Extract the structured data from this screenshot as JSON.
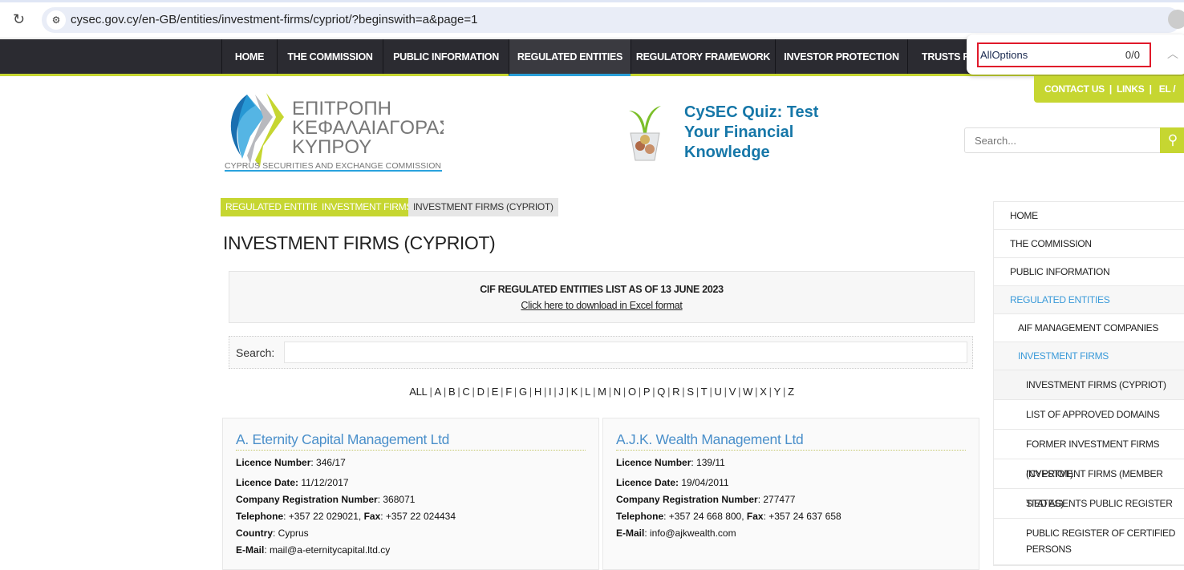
{
  "browser": {
    "url": "cysec.gov.cy/en-GB/entities/investment-firms/cypriot/?beginswith=a&page=1"
  },
  "find": {
    "query": "AllOptions",
    "count": "0/0"
  },
  "nav": [
    "HOME",
    "THE COMMISSION",
    "PUBLIC INFORMATION",
    "REGULATED ENTITIES",
    "REGULATORY FRAMEWORK",
    "INVESTOR PROTECTION",
    "TRUSTS RE"
  ],
  "toplinks": {
    "contact": "CONTACT US",
    "links": "LINKS",
    "lang": "EL / EN"
  },
  "logo": {
    "greek1": "ΕΠΙΤΡΟΠΗ",
    "greek2": "ΚΕΦΑΛΑΙΑΓΟΡΑΣ",
    "greek3": "ΚΥΠΡΟΥ",
    "english": "CYPRUS SECURITIES AND EXCHANGE COMMISSION"
  },
  "quiz": {
    "text": "CySEC Quiz: Test Your Financial Knowledge"
  },
  "search": {
    "placeholder": "Search..."
  },
  "breadcrumb": [
    "REGULATED ENTITIES",
    "INVESTMENT FIRMS",
    "INVESTMENT FIRMS (CYPRIOT)"
  ],
  "page_title": "INVESTMENT FIRMS (CYPRIOT)",
  "cif": {
    "title": "CIF REGULATED ENTITIES LIST AS OF 13 JUNE 2023",
    "link": "Click here to download in Excel format"
  },
  "filter": {
    "label": "Search:"
  },
  "alphabet": [
    "ALL",
    "A",
    "B",
    "C",
    "D",
    "E",
    "F",
    "G",
    "H",
    "I",
    "J",
    "K",
    "L",
    "M",
    "N",
    "O",
    "P",
    "Q",
    "R",
    "S",
    "T",
    "U",
    "V",
    "W",
    "X",
    "Y",
    "Z"
  ],
  "labels": {
    "licence_number": "Licence Number",
    "licence_date": "Licence Date:",
    "company_reg": "Company Registration Number",
    "telephone": "Telephone",
    "fax": "Fax",
    "country": "Country",
    "email": "E-Mail"
  },
  "firms": [
    {
      "name": "A. Eternity Capital Management Ltd",
      "licence_number": "346/17",
      "licence_date": "11/12/2017",
      "company_reg": "368071",
      "telephone": "+357 22 029021",
      "fax": "+357 22 024434",
      "country": "Cyprus",
      "email": "mail@a-eternitycapital.ltd.cy"
    },
    {
      "name": "A.J.K. Wealth Management Ltd",
      "licence_number": "139/11",
      "licence_date": "19/04/2011",
      "company_reg": "277477",
      "telephone": "+357 24 668 800",
      "fax": "+357 24 637 658",
      "email": "info@ajkwealth.com"
    }
  ],
  "sidebar": [
    "HOME",
    "THE COMMISSION",
    "PUBLIC INFORMATION",
    "REGULATED ENTITIES",
    "AIF MANAGEMENT COMPANIES",
    "INVESTMENT FIRMS",
    "INVESTMENT FIRMS (CYPRIOT)",
    "LIST OF APPROVED DOMAINS",
    "FORMER INVESTMENT FIRMS (CYPRIOT)",
    "INVESTMENT FIRMS (MEMBER STATES)",
    "TIED AGENTS PUBLIC REGISTER",
    "PUBLIC REGISTER OF CERTIFIED PERSONS"
  ],
  "colors": {
    "accent_green": "#c6d631",
    "nav_dark": "#2b2b31",
    "link_blue": "#4a8fca",
    "quiz_blue": "#1677a8"
  }
}
